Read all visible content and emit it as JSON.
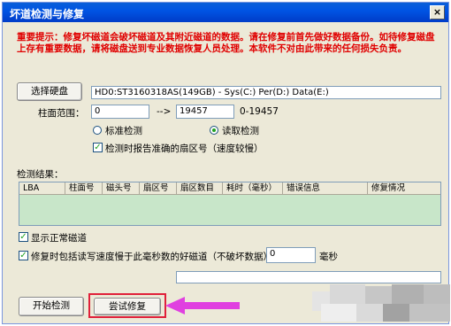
{
  "window": {
    "title": "坏道检测与修复",
    "close_symbol": "×"
  },
  "warning": {
    "text": "重要提示：修复坏磁道会破坏磁道及其附近磁道的数据。请在修复前首先做好数据备份。如待修复磁盘上存有重要数据，请将磁盘送到专业数据恢复人员处理。本软件不对由此带来的任何损失负责。"
  },
  "disk": {
    "button_label": "选择硬盘",
    "selected_disk": "HD0:ST3160318AS(149GB) - Sys(C:) Per(D:) Data(E:)"
  },
  "range": {
    "label": "柱面范围：",
    "start": "0",
    "arrow": "-->",
    "end": "19457",
    "hint": "0-19457"
  },
  "mode": {
    "standard_label": "标准检测",
    "read_label": "读取检测",
    "selected": "read"
  },
  "options": {
    "report_slow_label": "检测时报告准确的扇区号（速度较慢）",
    "report_slow_checked": true,
    "show_normal_label": "显示正常磁道",
    "show_normal_checked": true,
    "repair_slow_label": "修复时包括读写速度慢于此毫秒数的好磁道（不破坏数据）：",
    "repair_slow_checked": true,
    "repair_slow_value": "0",
    "repair_slow_unit": "毫秒"
  },
  "results": {
    "label": "检测结果：",
    "columns": [
      "LBA",
      "柱面号",
      "磁头号",
      "扇区号",
      "扇区数目",
      "耗时（毫秒）",
      "错误信息",
      "修复情况"
    ]
  },
  "actions": {
    "start_label": "开始检测",
    "repair_label": "尝试修复"
  },
  "colors": {
    "warning_text": "#e00000",
    "highlight": "#e0203a",
    "arrow": "#e040e0",
    "results_bg": "#c8e6c9"
  }
}
